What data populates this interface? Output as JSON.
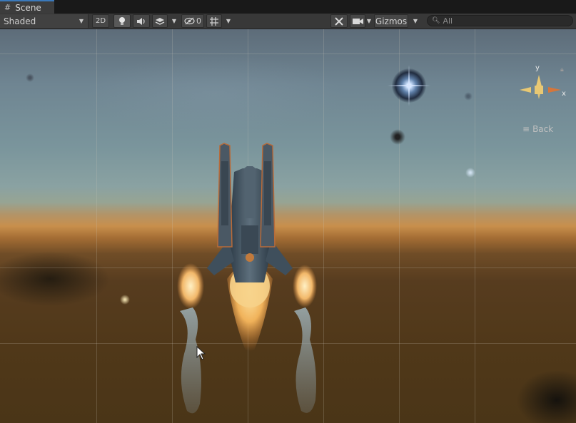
{
  "tab": {
    "title": "Scene",
    "icon": "scene-grid-icon"
  },
  "toolbar": {
    "shading_mode": "Shaded",
    "mode_2d_label": "2D",
    "hidden_count": "0",
    "gizmos_label": "Gizmos",
    "search_placeholder": "All",
    "icons": [
      "lighting-bulb-icon",
      "audio-speaker-icon",
      "effects-layers-icon",
      "scene-visibility-icon",
      "grid-snap-icon",
      "tools-icon",
      "camera-icon"
    ]
  },
  "orientation_gizmo": {
    "y_label": "y",
    "x_label": "x",
    "projection_label": "Back"
  },
  "colors": {
    "accent": "#3a79bb",
    "gizmo_yellow": "#e8c873",
    "gizmo_orange": "#d6763a",
    "sky_top": "#5d6c79",
    "ground": "#4a3517"
  }
}
